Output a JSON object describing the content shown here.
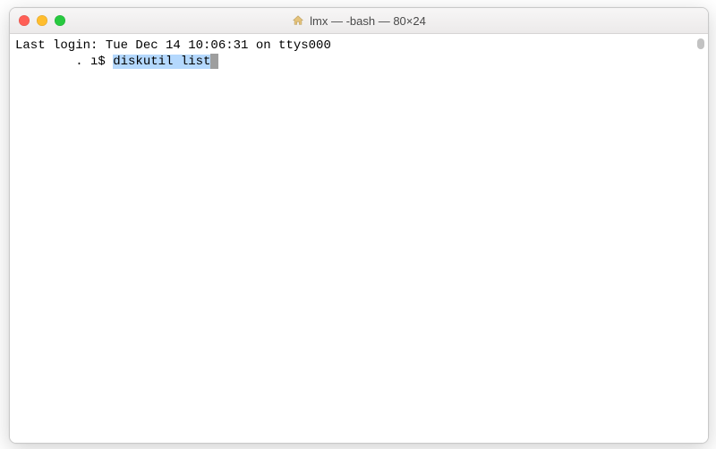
{
  "window": {
    "title": "lmx — -bash — 80×24"
  },
  "terminal": {
    "login_line": "Last login: Tue Dec 14 10:06:31 on ttys000",
    "prompt_prefix": "        . ı$ ",
    "command": "diskutil list"
  },
  "icons": {
    "home": "home-icon",
    "close": "close-icon",
    "minimize": "minimize-icon",
    "zoom": "zoom-icon"
  }
}
